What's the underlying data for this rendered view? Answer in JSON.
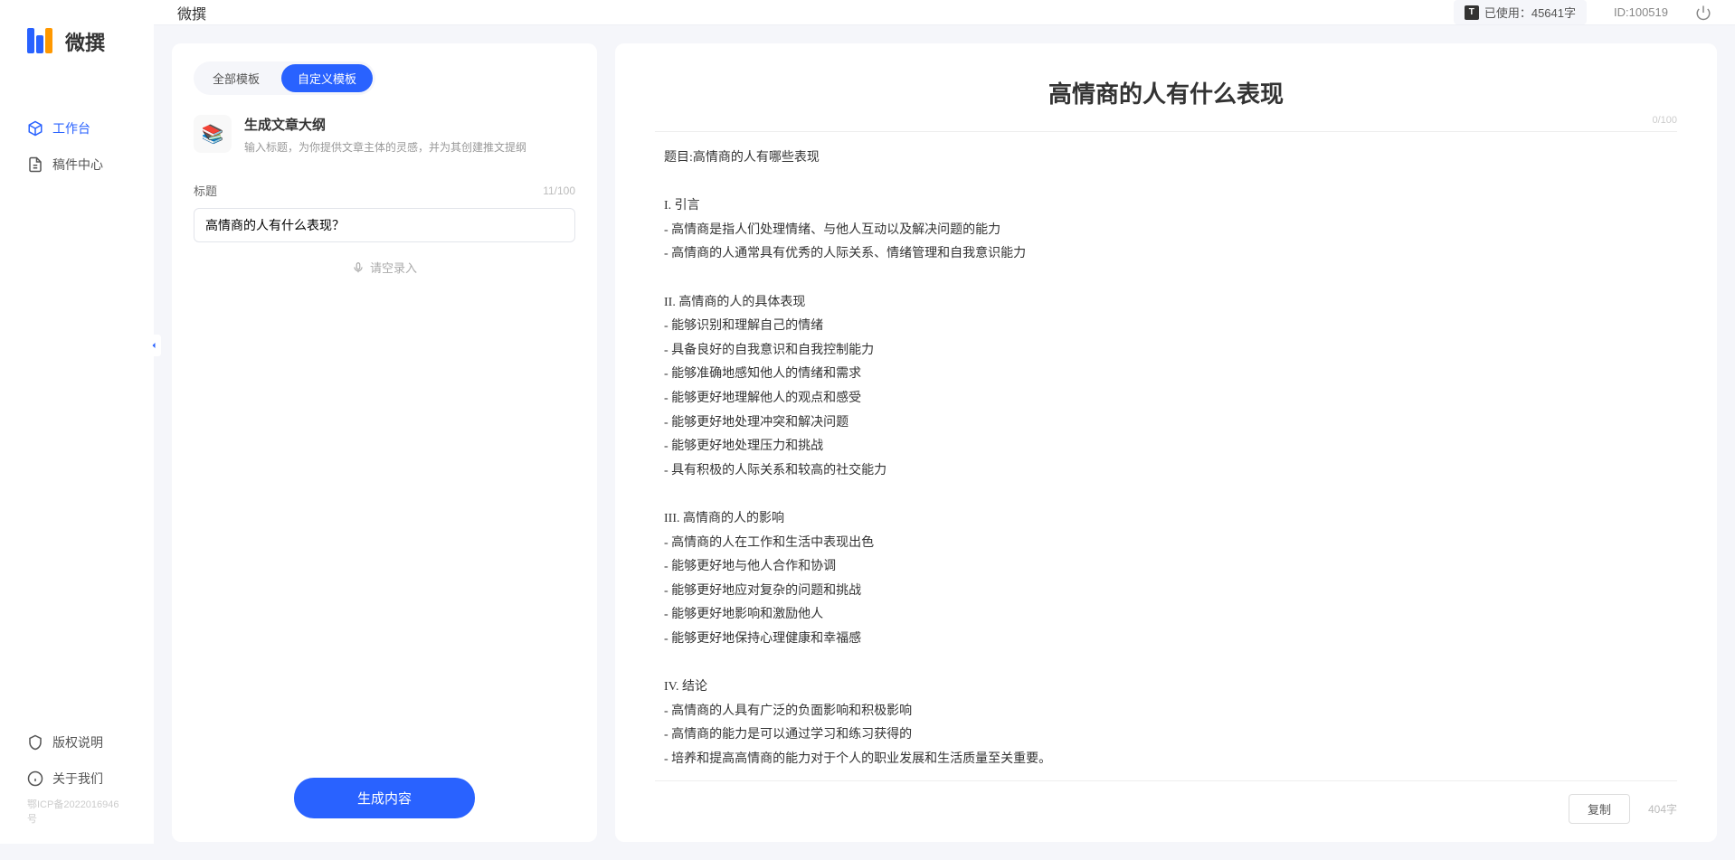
{
  "brand": "微撰",
  "nav": {
    "workbench": "工作台",
    "drafts": "稿件中心",
    "copyright": "版权说明",
    "about": "关于我们"
  },
  "icp": "鄂ICP备2022016946号",
  "header": {
    "title": "微撰",
    "usage_label": "已使用：45641字",
    "user_id": "ID:100519"
  },
  "tabs": {
    "all": "全部模板",
    "custom": "自定义模板"
  },
  "template": {
    "title": "生成文章大纲",
    "desc": "输入标题，为你提供文章主体的灵感，并为其创建推文提纲"
  },
  "field": {
    "label": "标题",
    "count": "11/100",
    "value": "高情商的人有什么表现？",
    "voice": "请空录入"
  },
  "generate_label": "生成内容",
  "output": {
    "title": "高情商的人有什么表现",
    "top_count": "0/100",
    "body": "题目:高情商的人有哪些表现\n\nI. 引言\n- 高情商是指人们处理情绪、与他人互动以及解决问题的能力\n- 高情商的人通常具有优秀的人际关系、情绪管理和自我意识能力\n\nII. 高情商的人的具体表现\n- 能够识别和理解自己的情绪\n- 具备良好的自我意识和自我控制能力\n- 能够准确地感知他人的情绪和需求\n- 能够更好地理解他人的观点和感受\n- 能够更好地处理冲突和解决问题\n- 能够更好地处理压力和挑战\n- 具有积极的人际关系和较高的社交能力\n\nIII. 高情商的人的影响\n- 高情商的人在工作和生活中表现出色\n- 能够更好地与他人合作和协调\n- 能够更好地应对复杂的问题和挑战\n- 能够更好地影响和激励他人\n- 能够更好地保持心理健康和幸福感\n\nIV. 结论\n- 高情商的人具有广泛的负面影响和积极影响\n- 高情商的能力是可以通过学习和练习获得的\n- 培养和提高高情商的能力对于个人的职业发展和生活质量至关重要。",
    "copy_label": "复制",
    "char_count": "404字"
  }
}
